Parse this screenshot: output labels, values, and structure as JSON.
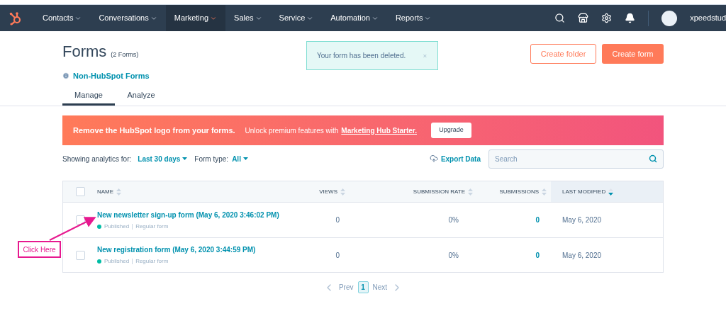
{
  "nav": {
    "items": [
      {
        "label": "Contacts",
        "selected": false
      },
      {
        "label": "Conversations",
        "selected": false
      },
      {
        "label": "Marketing",
        "selected": true
      },
      {
        "label": "Sales",
        "selected": false
      },
      {
        "label": "Service",
        "selected": false
      },
      {
        "label": "Automation",
        "selected": false
      },
      {
        "label": "Reports",
        "selected": false
      }
    ],
    "user": "xpeedstud"
  },
  "header": {
    "title": "Forms",
    "count": "(2 Forms)",
    "link": "Non-HubSpot Forms"
  },
  "toast": {
    "message": "Your form has been deleted."
  },
  "buttons": {
    "secondary": "Create folder",
    "primary": "Create form"
  },
  "tabs": [
    {
      "label": "Manage",
      "selected": true
    },
    {
      "label": "Analyze",
      "selected": false
    }
  ],
  "banner": {
    "headline": "Remove the HubSpot logo from your forms.",
    "text": "Unlock premium features with",
    "link": "Marketing Hub Starter.",
    "button": "Upgrade"
  },
  "filters": {
    "analytics_label": "Showing analytics for:",
    "analytics_value": "Last 30 days",
    "type_label": "Form type:",
    "type_value": "All",
    "export": "Export Data",
    "search_placeholder": "Search"
  },
  "table": {
    "select_all_checked": false,
    "columns": [
      {
        "label": "NAME",
        "sorted": false
      },
      {
        "label": "VIEWS",
        "sorted": false
      },
      {
        "label": "SUBMISSION RATE",
        "sorted": false
      },
      {
        "label": "SUBMISSIONS",
        "sorted": false
      },
      {
        "label": "LAST MODIFIED",
        "sorted": true
      }
    ],
    "rows": [
      {
        "name": "New newsletter sign-up form (May 6, 2020 3:46:02 PM)",
        "status": "Published",
        "type": "Regular form",
        "views": "0",
        "rate": "0%",
        "submissions": "0",
        "modified": "May 6, 2020",
        "checked": false
      },
      {
        "name": "New registration form (May 6, 2020 3:44:59 PM)",
        "status": "Published",
        "type": "Regular form",
        "views": "0",
        "rate": "0%",
        "submissions": "0",
        "modified": "May 6, 2020",
        "checked": false
      }
    ]
  },
  "pagination": {
    "prev": "Prev",
    "pages": [
      {
        "label": "1",
        "selected": true
      }
    ],
    "next": "Next"
  },
  "annotation": {
    "label": "Click Here"
  }
}
